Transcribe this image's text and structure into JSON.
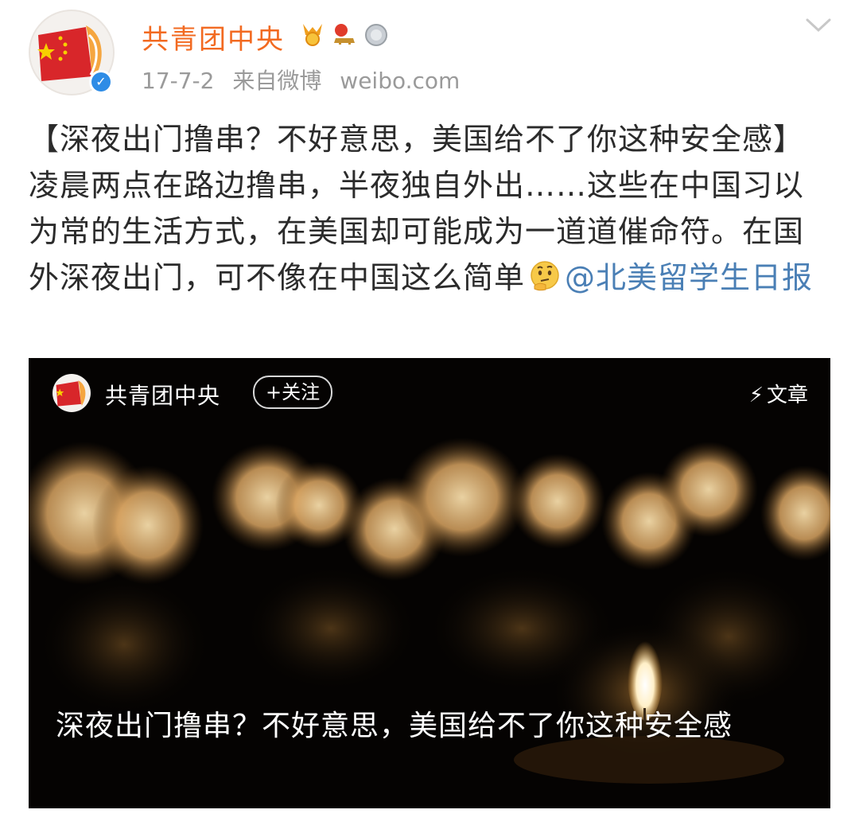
{
  "post": {
    "author": "共青团中央",
    "date": "17-7-2",
    "source": "来自微博",
    "source_site": "weibo.com",
    "text": "【深夜出门撸串？不好意思，美国给不了你这种安全感】凌晨两点在路边撸串，半夜独自外出……这些在中国习以为常的生活方式，在美国却可能成为一道道催命符。在国外深夜出门，可不像在中国这么简单",
    "emoji": "thinking-face-emoji",
    "mention": "@北美留学生日报",
    "badges": [
      "gold-medal-badge",
      "ribbon-badge",
      "silver-medal-badge"
    ]
  },
  "card": {
    "author": "共青团中央",
    "follow_label": "+关注",
    "tag_label": "文章",
    "caption": "深夜出门撸串？不好意思，美国给不了你这种安全感"
  },
  "colors": {
    "username": "#f26a21",
    "meta": "#9a9a9a",
    "mention": "#4a7fb5",
    "verified": "#2e8ce6"
  }
}
